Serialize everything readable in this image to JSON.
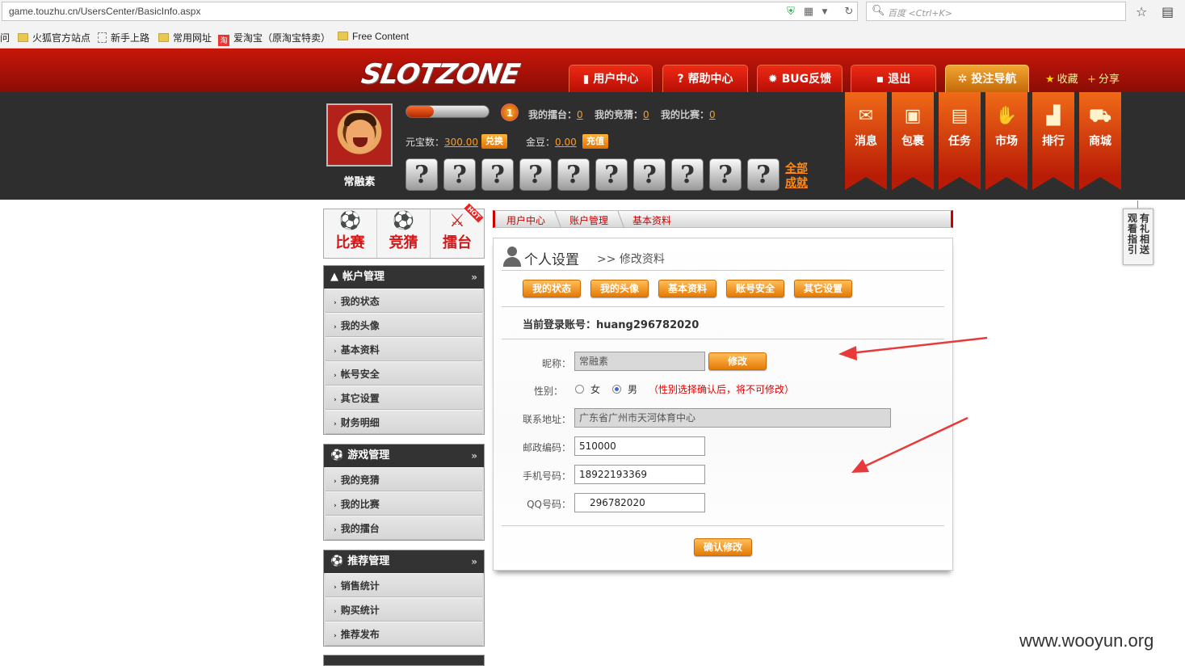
{
  "browser": {
    "url": "game.touzhu.cn/UsersCenter/BasicInfo.aspx",
    "search_placeholder": "百度 <Ctrl+K>",
    "bookmarks": [
      {
        "label": "问"
      },
      {
        "label": "火狐官方站点"
      },
      {
        "label": "新手上路"
      },
      {
        "label": "常用网址"
      },
      {
        "label": "爱淘宝（原淘宝特卖）"
      },
      {
        "label": "Free Content"
      }
    ]
  },
  "header": {
    "logo": "SLOTZONE",
    "nav": [
      "用户中心",
      "帮助中心",
      "BUG反馈",
      "退出",
      "投注导航"
    ],
    "links": [
      "收藏",
      "分享"
    ]
  },
  "user": {
    "name": "常融素",
    "level": "1",
    "level_progress": 0.33,
    "stats": [
      {
        "label": "我的擂台：",
        "value": "0"
      },
      {
        "label": "我的竞猜：",
        "value": "0"
      },
      {
        "label": "我的比赛：",
        "value": "0"
      }
    ],
    "yuanbao_label": "元宝数：",
    "yuanbao_value": "300.00",
    "exchange_btn": "兑换",
    "jindou_label": "金豆：",
    "jindou_value": "0.00",
    "recharge_btn": "充值",
    "achievement_symbol": "?",
    "all_achievements": "全部成就"
  },
  "banners": [
    "消息",
    "包裹",
    "任务",
    "市场",
    "排行",
    "商城"
  ],
  "game_tabs": [
    "比赛",
    "竞猜",
    "擂台"
  ],
  "sidebar": {
    "account": {
      "title": "帐户管理",
      "more": "»",
      "items": [
        "我的状态",
        "我的头像",
        "基本资料",
        "帐号安全",
        "其它设置",
        "财务明细"
      ]
    },
    "game": {
      "title": "游戏管理",
      "more": "»",
      "items": [
        "我的竞猜",
        "我的比赛",
        "我的擂台"
      ]
    },
    "recommend": {
      "title": "推荐管理",
      "more": "»",
      "items": [
        "销售统计",
        "购买统计",
        "推荐发布"
      ]
    }
  },
  "breadcrumb": [
    "用户中心",
    "账户管理",
    "基本资料"
  ],
  "main": {
    "title": "个人设置",
    "subtitle": ">> 修改资料",
    "tabs": [
      "我的状态",
      "我的头像",
      "基本资料",
      "账号安全",
      "其它设置"
    ],
    "account_label": "当前登录账号：",
    "account_value": "huang296782020",
    "nickname_label": "昵称：",
    "nickname_value": "常融素",
    "modify_btn": "修改",
    "gender_label": "性别：",
    "gender_female": "女",
    "gender_male": "男",
    "gender_note": "（性别选择确认后，将不可修改）",
    "address_label": "联系地址：",
    "address_value": "广东省广州市天河体育中心",
    "zip_label": "邮政编码：",
    "zip_value": "510000",
    "phone_label": "手机号码：",
    "phone_value": "18922193369",
    "qq_label": "QQ号码：",
    "qq_value": "296782020",
    "confirm_btn": "确认修改"
  },
  "float_tab": {
    "col1": "观看指引",
    "col2": "有礼相送"
  },
  "watermark": "www.wooyun.org",
  "colors": {
    "brand_red": "#c8160a",
    "accent_orange": "#f08a10",
    "annotation_arrow": "#e83a3a"
  }
}
